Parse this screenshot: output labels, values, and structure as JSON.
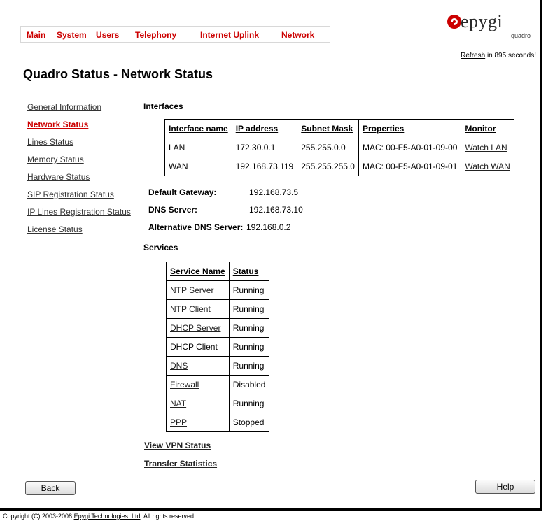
{
  "menu": {
    "items": [
      "Main",
      "System",
      "Users",
      "Telephony",
      "Internet Uplink",
      "Network"
    ]
  },
  "logo": {
    "word": "epygi",
    "sub": "quadro",
    "brand_color": "#cc0000"
  },
  "refresh": {
    "link": "Refresh",
    "suffix": "in 895 seconds!"
  },
  "page_title": "Quadro Status - Network Status",
  "sidebar": {
    "items": [
      "General Information",
      "Network Status",
      "Lines Status",
      "Memory Status",
      "Hardware Status",
      "SIP Registration Status",
      "IP Lines Registration Status",
      "License Status"
    ],
    "active_index": 1
  },
  "interfaces": {
    "title": "Interfaces",
    "headers": [
      "Interface name",
      "IP address",
      "Subnet Mask",
      "Properties",
      "Monitor"
    ],
    "rows": [
      [
        "LAN",
        "172.30.0.1",
        "255.255.0.0",
        "MAC: 00-F5-A0-01-09-00",
        "Watch LAN"
      ],
      [
        "WAN",
        "192.168.73.119",
        "255.255.255.0",
        "MAC: 00-F5-A0-01-09-01",
        "Watch WAN"
      ]
    ]
  },
  "network": {
    "default_gateway_label": "Default Gateway:",
    "default_gateway": "192.168.73.5",
    "dns_label": "DNS Server:",
    "dns": "192.168.73.10",
    "alt_dns_label": "Alternative DNS Server:",
    "alt_dns": "192.168.0.2"
  },
  "services": {
    "title": "Services",
    "headers": [
      "Service Name",
      "Status"
    ],
    "rows": [
      [
        "NTP Server",
        "Running"
      ],
      [
        "NTP Client",
        "Running"
      ],
      [
        "DHCP Server",
        "Running"
      ],
      [
        "DHCP Client",
        "Running"
      ],
      [
        "DNS",
        "Running"
      ],
      [
        "Firewall",
        "Disabled"
      ],
      [
        "NAT",
        "Running"
      ],
      [
        "PPP",
        "Stopped"
      ]
    ]
  },
  "links": {
    "vpn": "View VPN Status",
    "transfer": "Transfer Statistics"
  },
  "buttons": {
    "back": "Back",
    "help": "Help"
  },
  "copyright": {
    "prefix": "Copyright (C) 2003-2008",
    "company": "Epygi Technologies, Ltd",
    "suffix": ". All rights reserved."
  }
}
